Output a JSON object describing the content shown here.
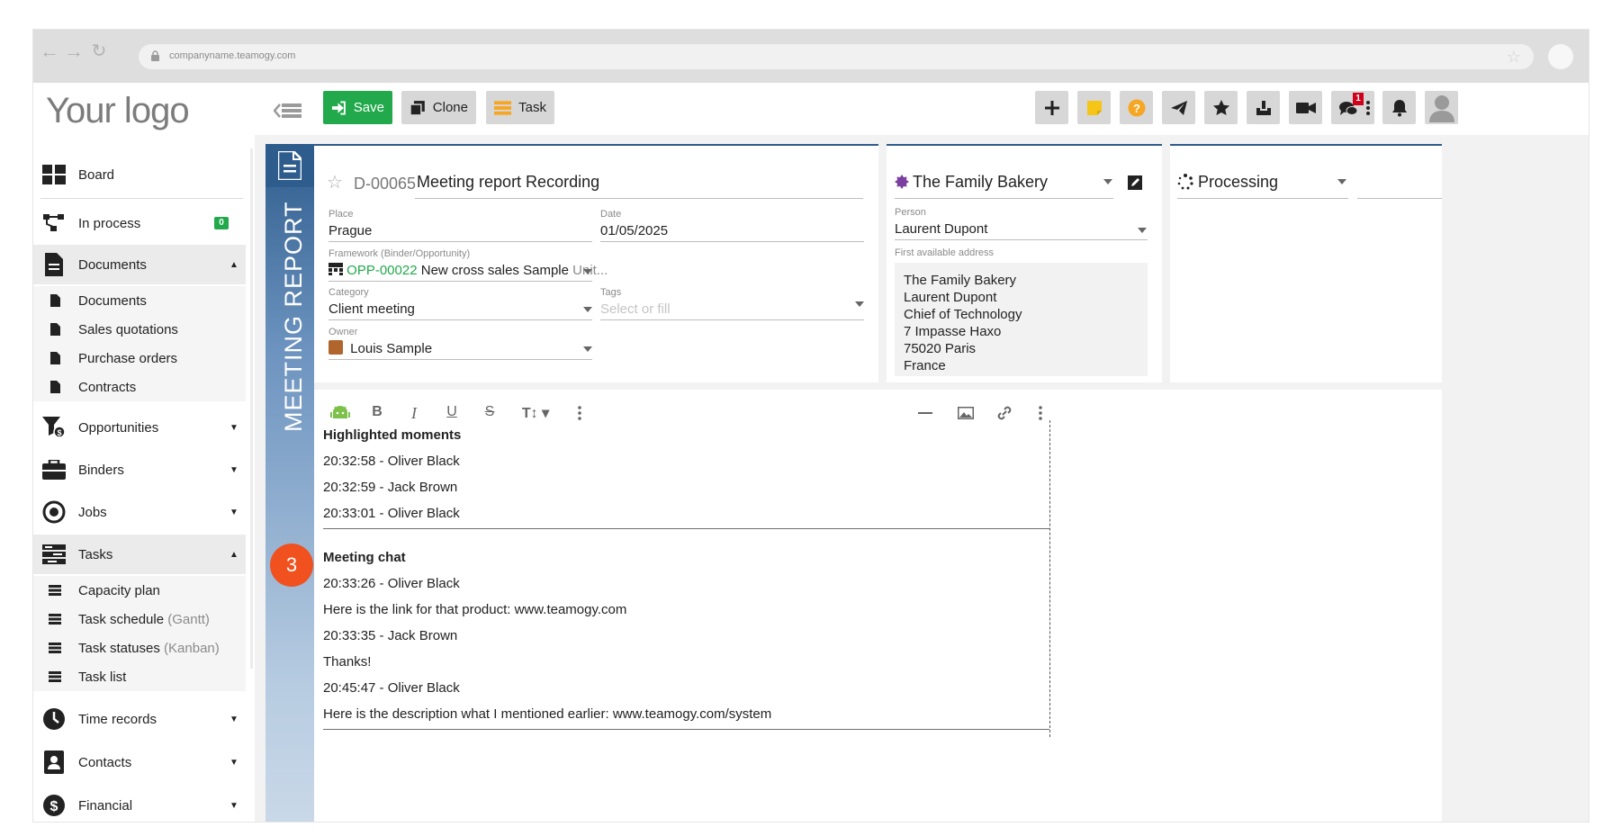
{
  "browser": {
    "url": "companyname.teamogy.com"
  },
  "logo": {
    "text": "Your logo"
  },
  "toolbar": {
    "save_label": "Save",
    "clone_label": "Clone",
    "task_label": "Task",
    "notif_count": "1",
    "colors": {
      "save": "#21a94b",
      "accent_orange": "#f5a623",
      "chat_badge": "#d0021b"
    }
  },
  "sidebar": {
    "board": "Board",
    "in_process": "In process",
    "in_process_count": "0",
    "documents": "Documents",
    "documents_items": [
      "Documents",
      "Sales quotations",
      "Purchase orders",
      "Contracts"
    ],
    "opportunities": "Opportunities",
    "binders": "Binders",
    "jobs": "Jobs",
    "tasks": "Tasks",
    "tasks_items": [
      {
        "label": "Capacity plan",
        "suffix": ""
      },
      {
        "label": "Task schedule",
        "suffix": "(Gantt)"
      },
      {
        "label": "Task statuses",
        "suffix": "(Kanban)"
      },
      {
        "label": "Task list",
        "suffix": ""
      }
    ],
    "time_records": "Time records",
    "contacts": "Contacts",
    "financial": "Financial"
  },
  "record": {
    "type_label": "MEETING REPORT",
    "id": "D-00065",
    "title": "Meeting report Recording",
    "place_label": "Place",
    "place": "Prague",
    "date_label": "Date",
    "date": "01/05/2025",
    "framework_label": "Framework (Binder/Opportunity)",
    "framework_id": "OPP-00022",
    "framework_name": "New cross sales Sample",
    "framework_suffix": "Unit...",
    "category_label": "Category",
    "category": "Client meeting",
    "tags_label": "Tags",
    "tags_placeholder": "Select or fill",
    "owner_label": "Owner",
    "owner": "Louis Sample"
  },
  "client": {
    "company": "The Family Bakery",
    "person_label": "Person",
    "person": "Laurent Dupont",
    "address_label": "First available address",
    "address_lines": [
      "The Family Bakery",
      "Laurent Dupont",
      "Chief of Technology",
      "7 Impasse Haxo",
      "75020 Paris",
      "France"
    ]
  },
  "status": {
    "label": "Processing"
  },
  "step_marker": "3",
  "editor": {
    "sections": [
      {
        "heading": "Highlighted moments",
        "lines": [
          "20:32:58 - Oliver Black",
          "20:32:59 - Jack Brown",
          "20:33:01 - Oliver Black"
        ]
      },
      {
        "heading": "Meeting chat",
        "lines": [
          "20:33:26 - Oliver Black",
          "Here is the link for that product: www.teamogy.com",
          "20:33:35 -  Jack Brown",
          "Thanks!",
          "20:45:47 - Oliver Black",
          "Here is the description what I mentioned earlier: www.teamogy.com/system"
        ]
      }
    ]
  }
}
